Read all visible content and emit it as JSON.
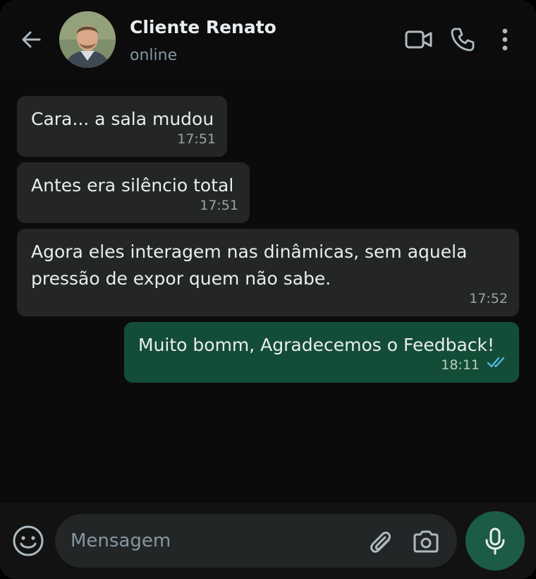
{
  "header": {
    "contact_name": "Cliente Renato",
    "contact_status": "online",
    "icons": [
      "back-arrow-icon",
      "video-call-icon",
      "voice-call-icon",
      "more-options-icon"
    ]
  },
  "messages": [
    {
      "direction": "incoming",
      "lines": [
        "Cara... a sala mudou"
      ],
      "time": "17:51"
    },
    {
      "direction": "incoming",
      "lines": [
        "Antes era silêncio total"
      ],
      "time": "17:51"
    },
    {
      "direction": "incoming",
      "lines": [
        "Agora eles interagem nas dinâmicas, sem aquela",
        "pressão de expor quem não sabe."
      ],
      "time": "17:52"
    },
    {
      "direction": "outgoing",
      "lines": [
        "Muito bomm, Agradecemos o Feedback!"
      ],
      "time": "18:11",
      "status": "read"
    }
  ],
  "composer": {
    "placeholder": "Mensagem",
    "value": "",
    "icons": [
      "emoji-icon",
      "attach-icon",
      "camera-icon",
      "mic-icon"
    ]
  },
  "colors": {
    "background": "#0b0b0b",
    "incoming_bubble": "#242626",
    "outgoing_bubble": "#144d37",
    "mic_button": "#1c5b45",
    "read_ticks": "#53bdeb"
  }
}
